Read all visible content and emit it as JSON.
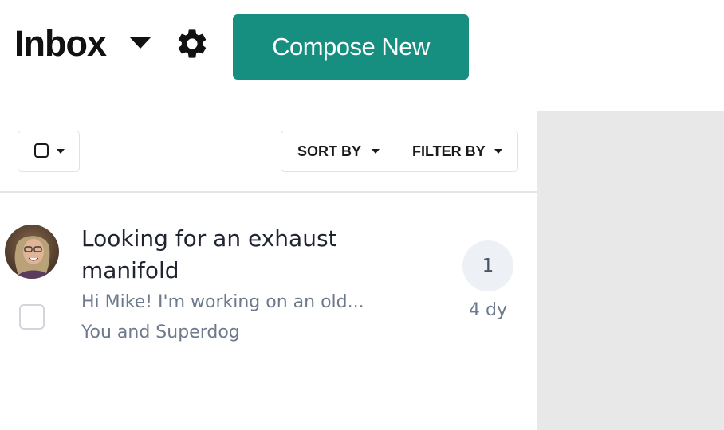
{
  "header": {
    "title": "Inbox",
    "compose_label": "Compose New",
    "accent_color": "#178f80"
  },
  "toolbar": {
    "sort_label": "SORT BY",
    "filter_label": "FILTER BY"
  },
  "messages": [
    {
      "subject": "Looking for an exhaust manifold",
      "preview": "Hi Mike! I'm working on an old...",
      "participants": "You and Superdog",
      "count": "1",
      "age": "4 dy",
      "checked": false
    }
  ],
  "icons": {
    "title_dropdown": "caret-down-icon",
    "settings": "gear-icon",
    "select_all": "checkbox-icon",
    "dropdown": "caret-down-icon"
  }
}
